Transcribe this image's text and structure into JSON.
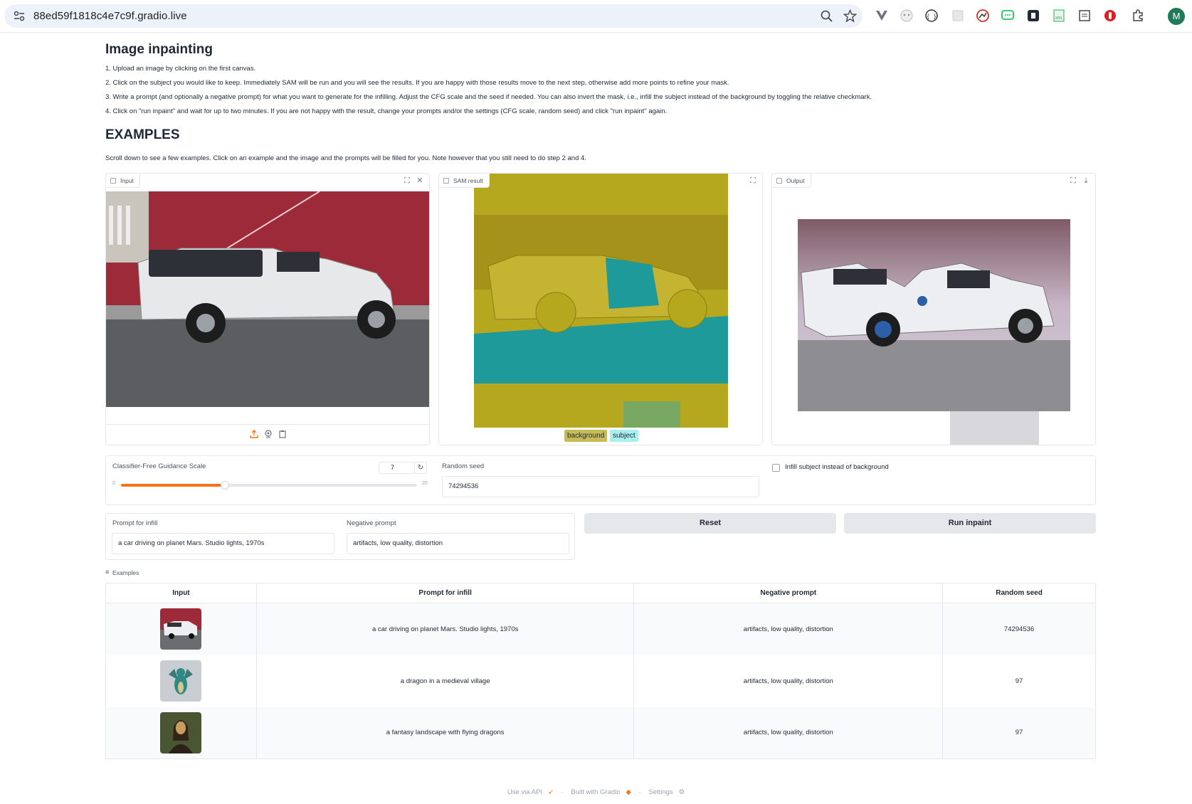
{
  "browser": {
    "url": "88ed59f1818c4e7c9f.gradio.live",
    "avatar_initial": "M"
  },
  "app": {
    "title": "Image inpainting",
    "steps": [
      "1. Upload an image by clicking on the first canvas.",
      "2. Click on the subject you would like to keep. Immediately SAM will be run and you will see the results. If you are happy with those results move to the next step, otherwise add more points to refine your mask.",
      "3. Write a prompt (and optionally a negative prompt) for what you want to generate for the infilling. Adjust the CFG scale and the seed if needed. You can also invert the mask, i.e., infill the subject instead of the background by toggling the relative checkmark.",
      "4. Click on \"run inpaint\" and wait for up to two minutes. If you are not happy with the result, change your prompts and/or the settings (CFG scale, random seed) and click \"run inpaint\" again."
    ],
    "examples_heading": "EXAMPLES",
    "examples_note": "Scroll down to see a few examples. Click on an example and the image and the prompts will be filled for you. Note however that you still need to do step 2 and 4."
  },
  "panels": {
    "input_label": "Input",
    "sam_label": "SAM result",
    "output_label": "Output",
    "legend": [
      "background",
      "subject"
    ]
  },
  "controls": {
    "cfg_label": "Classifier-Free Guidance Scale",
    "cfg_value": "7",
    "cfg_min": "0",
    "cfg_max": "20",
    "cfg_fraction": 0.35,
    "seed_label": "Random seed",
    "seed_value": "74294536",
    "infill_label": "Infill subject instead of background",
    "prompt_label": "Prompt for infill",
    "prompt_value": "a car driving on planet Mars. Studio lights, 1970s",
    "neg_label": "Negative prompt",
    "neg_value": "artifacts, low quality, distortion",
    "reset_label": "Reset",
    "run_label": "Run inpaint"
  },
  "examples": {
    "label": "Examples",
    "headers": [
      "Input",
      "Prompt for infill",
      "Negative prompt",
      "Random seed"
    ],
    "rows": [
      {
        "prompt": "a car driving on planet Mars. Studio lights, 1970s",
        "negative": "artifacts, low quality, distortion",
        "seed": "74294536"
      },
      {
        "prompt": "a dragon in a medieval village",
        "negative": "artifacts, low quality, distortion",
        "seed": "97"
      },
      {
        "prompt": "a fantasy landscape with flying dragons",
        "negative": "artifacts, low quality, distortion",
        "seed": "97"
      }
    ]
  },
  "footer": {
    "api": "Use via API",
    "built": "Built with Gradio",
    "settings": "Settings",
    "sep": "·"
  },
  "colors": {
    "accent": "#f97316",
    "sam_background": "#b5a81f",
    "sam_subject": "#1f9a9a",
    "legend_background": "#c8bb55",
    "legend_subject": "#a8f0f0"
  }
}
